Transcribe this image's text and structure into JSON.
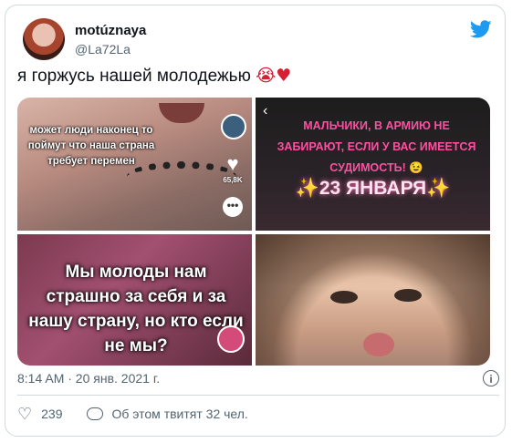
{
  "tweet": {
    "display_name": "motúznaya",
    "handle": "@La72La",
    "text": "я горжусь нашей молодежью",
    "emojis": "😭♥",
    "timestamp": "8:14 AM · 20 янв. 2021 г.",
    "likes": "239",
    "discussion": "Об этом твитят 32 чел."
  },
  "media": {
    "tile1": {
      "caption": "может люди наконец то поймут что наша страна требует перемен",
      "likes": "65,8K"
    },
    "tile2": {
      "caption": "МАЛЬЧИКИ, В АРМИЮ НЕ ЗАБИРАЮТ, ЕСЛИ У ВАС ИМЕЕТСЯ СУДИМОСТЬ! 😉",
      "date": "✨23 ЯНВАРЯ✨"
    },
    "tile3": {
      "caption": "Мы молоды нам страшно за себя и за нашу страну, но кто если не мы?"
    }
  },
  "colors": {
    "twitter_blue": "#1d9bf0",
    "secondary_text": "#536471",
    "border": "#cfd9de",
    "heart_red": "#d81e34"
  },
  "icons": [
    "twitter-bird-icon",
    "heart-icon",
    "comment-icon",
    "info-icon",
    "back-icon"
  ]
}
